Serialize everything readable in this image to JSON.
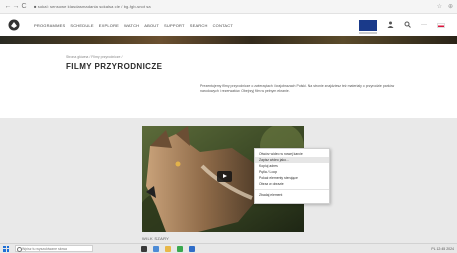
{
  "browser": {
    "back": "←",
    "forward": "→",
    "reload": "C",
    "url": "■ sokal: sensowe klasdasmadania sokalsa cle / bg-fgb-snot sa",
    "right_icons": [
      "☆",
      "⊕"
    ]
  },
  "header": {
    "menu": [
      "PROGRAMMES",
      "SCHEDULE",
      "EXPLORE",
      "WATCH",
      "ABOUT",
      "SUPPORT",
      "SEARCH",
      "CONTACT"
    ],
    "icons": [
      "person-icon",
      "search-icon",
      "menu-icon"
    ],
    "more_label": "···"
  },
  "page": {
    "breadcrumb": "Strona główna  /  Filmy przyrodnicze  /",
    "title": "FILMY PRZYRODNICZE",
    "description": "Prezentujemy filmy przyrodnicze o zwierzętach i krajobrazach Polski. Na stronie znajdziesz też materiały o przyrodzie parków narodowych i rezerwatów. Obejrzyj film w pełnym ekranie."
  },
  "video": {
    "caption": "WILK SZARY"
  },
  "context_menu": {
    "items": [
      "Otwórz wideo w nowej karcie",
      "Zapisz wideo jako...",
      "Kopiuj adres",
      "Pętla / Loop",
      "Pokaż elementy sterujące",
      "Obraz w obrazie",
      "Zbadaj element"
    ]
  },
  "taskbar": {
    "search_placeholder": "Wpisz tu wyszukiwane słowa",
    "tray_text": "PL  12:45  2024"
  }
}
